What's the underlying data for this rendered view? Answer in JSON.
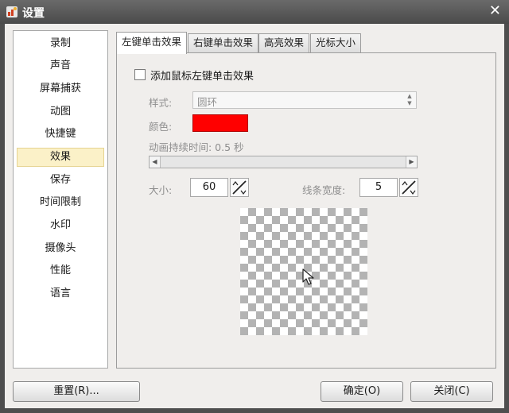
{
  "window": {
    "title": "设置"
  },
  "sidebar": {
    "items": [
      "录制",
      "声音",
      "屏幕捕获",
      "动图",
      "快捷键",
      "效果",
      "保存",
      "时间限制",
      "水印",
      "摄像头",
      "性能",
      "语言"
    ],
    "selected": "效果"
  },
  "tabs": [
    "左键单击效果",
    "右键单击效果",
    "高亮效果",
    "光标大小"
  ],
  "active_tab": "左键单击效果",
  "panel": {
    "enable_label": "添加鼠标左键单击效果",
    "enable_checked": false,
    "style_label": "样式:",
    "style_value": "圆环",
    "color_label": "颜色:",
    "color_value": "#ff0000",
    "duration_label": "动画持续时间: 0.5 秒",
    "size_label": "大小:",
    "size_value": "60",
    "line_width_label": "线条宽度:",
    "line_width_value": "5"
  },
  "buttons": {
    "reset": "重置(R)...",
    "ok": "确定(O)",
    "close": "关闭(C)"
  },
  "icons": {
    "app": "app-recorder-icon",
    "close": "close-icon",
    "cursor": "mouse-cursor-icon"
  }
}
